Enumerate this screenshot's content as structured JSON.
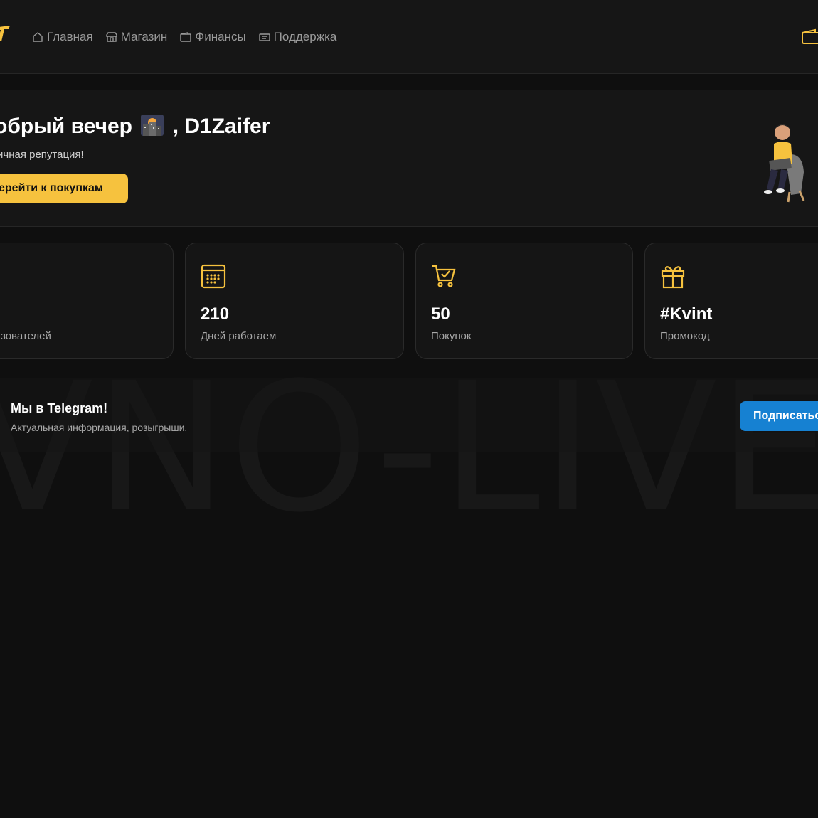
{
  "watermark": "VNO-LIVE",
  "nav": {
    "items": [
      {
        "label": "Главная",
        "icon": "home-icon"
      },
      {
        "label": "Магазин",
        "icon": "store-icon"
      },
      {
        "label": "Финансы",
        "icon": "wallet-icon"
      },
      {
        "label": "Поддержка",
        "icon": "ticket-icon"
      }
    ]
  },
  "hero": {
    "greeting_prefix": "обрый вечер",
    "greeting_emoji": "city-dusk-icon",
    "greeting_name": ", D1Zaifer",
    "reputation": "ичная репутация!",
    "shop_button": "ерейти к покупкам"
  },
  "stats": [
    {
      "value": "",
      "label": "зователей",
      "icon": "users-icon"
    },
    {
      "value": "210",
      "label": "Дней работаем",
      "icon": "calendar-icon"
    },
    {
      "value": "50",
      "label": "Покупок",
      "icon": "cart-check-icon"
    },
    {
      "value": "#Kvint",
      "label": "Промокод",
      "icon": "gift-icon"
    }
  ],
  "telegram": {
    "title": "Мы в Telegram!",
    "subtitle": "Актуальная информация, розыгрыши.",
    "button": "Подписаться"
  },
  "colors": {
    "accent": "#f6c23e",
    "telegram_blue": "#1681d2",
    "background": "#0f0f0f",
    "panel": "#161616"
  }
}
